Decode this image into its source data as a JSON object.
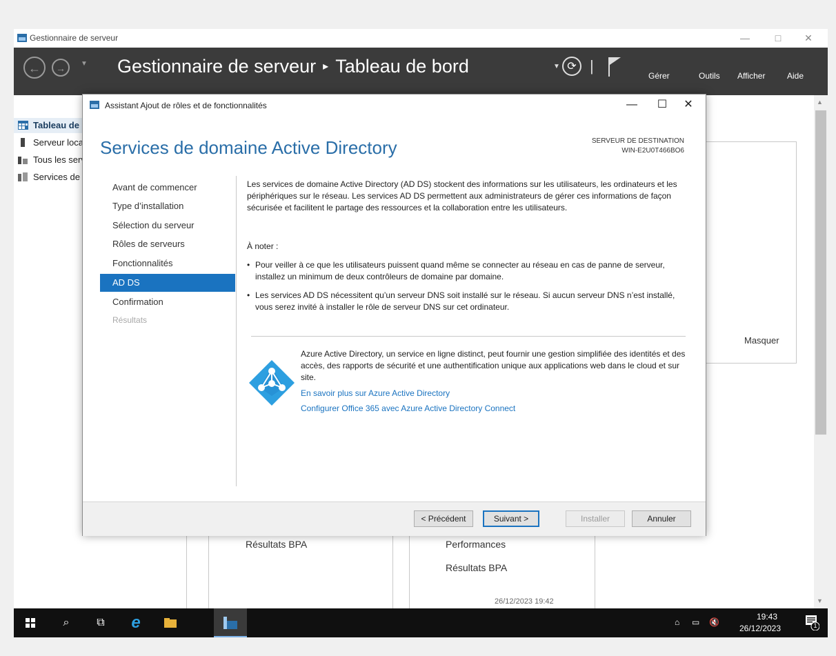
{
  "window": {
    "title": "Gestionnaire de serveur",
    "controls": {
      "minimize": "—",
      "maximize": "□",
      "close": "✕"
    }
  },
  "header": {
    "app": "Gestionnaire de serveur",
    "separator": "▸",
    "page": "Tableau de bord",
    "menu": [
      "Gérer",
      "Outils",
      "Afficher",
      "Aide"
    ]
  },
  "sidebar": {
    "items": [
      {
        "label": "Tableau de bord",
        "icon": "dashboard-icon"
      },
      {
        "label": "Serveur local",
        "icon": "server-icon"
      },
      {
        "label": "Tous les serveurs",
        "icon": "servers-icon"
      },
      {
        "label": "Services de fichiers et de stockage",
        "icon": "file-services-icon"
      }
    ]
  },
  "background": {
    "masquer": "Masquer",
    "bpa_left": "Résultats BPA",
    "performances": "Performances",
    "bpa_right": "Résultats BPA",
    "date": "26/12/2023 19:42"
  },
  "dialog": {
    "title": "Assistant Ajout de rôles et de fonctionnalités",
    "heading": "Services de domaine Active Directory",
    "destination_label": "SERVEUR DE DESTINATION",
    "destination_value": "WIN-E2U0T466BO6",
    "nav": [
      {
        "label": "Avant de commencer",
        "state": "normal"
      },
      {
        "label": "Type d’installation",
        "state": "normal"
      },
      {
        "label": "Sélection du serveur",
        "state": "normal"
      },
      {
        "label": "Rôles de serveurs",
        "state": "normal"
      },
      {
        "label": "Fonctionnalités",
        "state": "normal"
      },
      {
        "label": "AD DS",
        "state": "active"
      },
      {
        "label": "Confirmation",
        "state": "normal"
      },
      {
        "label": "Résultats",
        "state": "disabled"
      }
    ],
    "intro": "Les services de domaine Active Directory (AD DS) stockent des informations sur les utilisateurs, les ordinateurs et les périphériques sur le réseau. Les services AD DS permettent aux administrateurs de gérer ces informations de façon sécurisée et facilitent le partage des ressources et la collaboration entre les utilisateurs.",
    "note_label": "À noter :",
    "bullets": [
      "Pour veiller à ce que les utilisateurs puissent quand même se connecter au réseau en cas de panne de serveur, installez un minimum de deux contrôleurs de domaine par domaine.",
      "Les services AD DS nécessitent qu’un serveur DNS soit installé sur le réseau. Si aucun serveur DNS n’est installé, vous serez invité à installer le rôle de serveur DNS sur cet ordinateur."
    ],
    "azure_text": "Azure Active Directory, un service en ligne distinct, peut fournir une gestion simplifiée des identités et des accès, des rapports de sécurité et une authentification unique aux applications web dans le cloud et sur site.",
    "links": [
      "En savoir plus sur Azure Active Directory",
      "Configurer Office 365 avec Azure Active Directory Connect"
    ],
    "buttons": {
      "previous": "< Précédent",
      "next": "Suivant >",
      "install": "Installer",
      "cancel": "Annuler"
    }
  },
  "taskbar": {
    "time": "19:43",
    "date": "26/12/2023",
    "notification_count": "1"
  },
  "colors": {
    "accent": "#1a73c0",
    "header_bg": "#3b3b3b",
    "heading_blue": "#2a6ea8",
    "taskbar_bg": "#101010"
  }
}
